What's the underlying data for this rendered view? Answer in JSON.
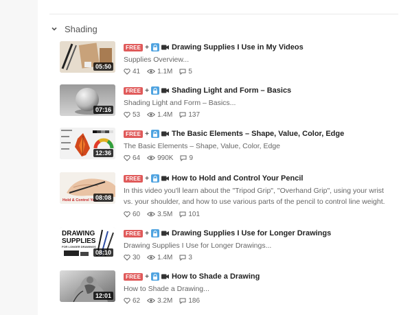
{
  "section": {
    "title": "Shading",
    "expanded": true
  },
  "badge": {
    "free": "FREE",
    "plus": "+"
  },
  "colors": {
    "free_badge": "#e05a5a",
    "lock_badge": "#4fa3e0"
  },
  "lessons": [
    {
      "title": "Drawing Supplies I Use in My Videos",
      "description": "Supplies Overview...",
      "duration": "05:50",
      "likes": "41",
      "views": "1.1M",
      "comments": "5"
    },
    {
      "title": "Shading Light and Form – Basics",
      "description": "Shading Light and Form – Basics...",
      "duration": "07:16",
      "likes": "53",
      "views": "1.4M",
      "comments": "137"
    },
    {
      "title": "The Basic Elements – Shape, Value, Color, Edge",
      "description": "The Basic Elements – Shape, Value, Color, Edge",
      "duration": "12:36",
      "likes": "64",
      "views": "990K",
      "comments": "9"
    },
    {
      "title": "How to Hold and Control Your Pencil",
      "description": "In this video you'll learn about the \"Tripod Grip\", \"Overhand Grip\", using your wrist vs. your shoulder, and how to use various parts of the pencil to control line weight.",
      "duration": "08:08",
      "likes": "60",
      "views": "3.5M",
      "comments": "101",
      "thumb_text": "Hold & Control Your"
    },
    {
      "title": "Drawing Supplies I Use for Longer Drawings",
      "description": "Drawing Supplies I Use for Longer Drawings...",
      "duration": "08:10",
      "likes": "30",
      "views": "1.4M",
      "comments": "3",
      "thumb_text": [
        "DRAWING",
        "SUPPLIES",
        "FOR LONGER DRAWINGS"
      ]
    },
    {
      "title": "How to Shade a Drawing",
      "description": "How to Shade a Drawing...",
      "duration": "12:01",
      "likes": "62",
      "views": "3.2M",
      "comments": "186"
    }
  ]
}
